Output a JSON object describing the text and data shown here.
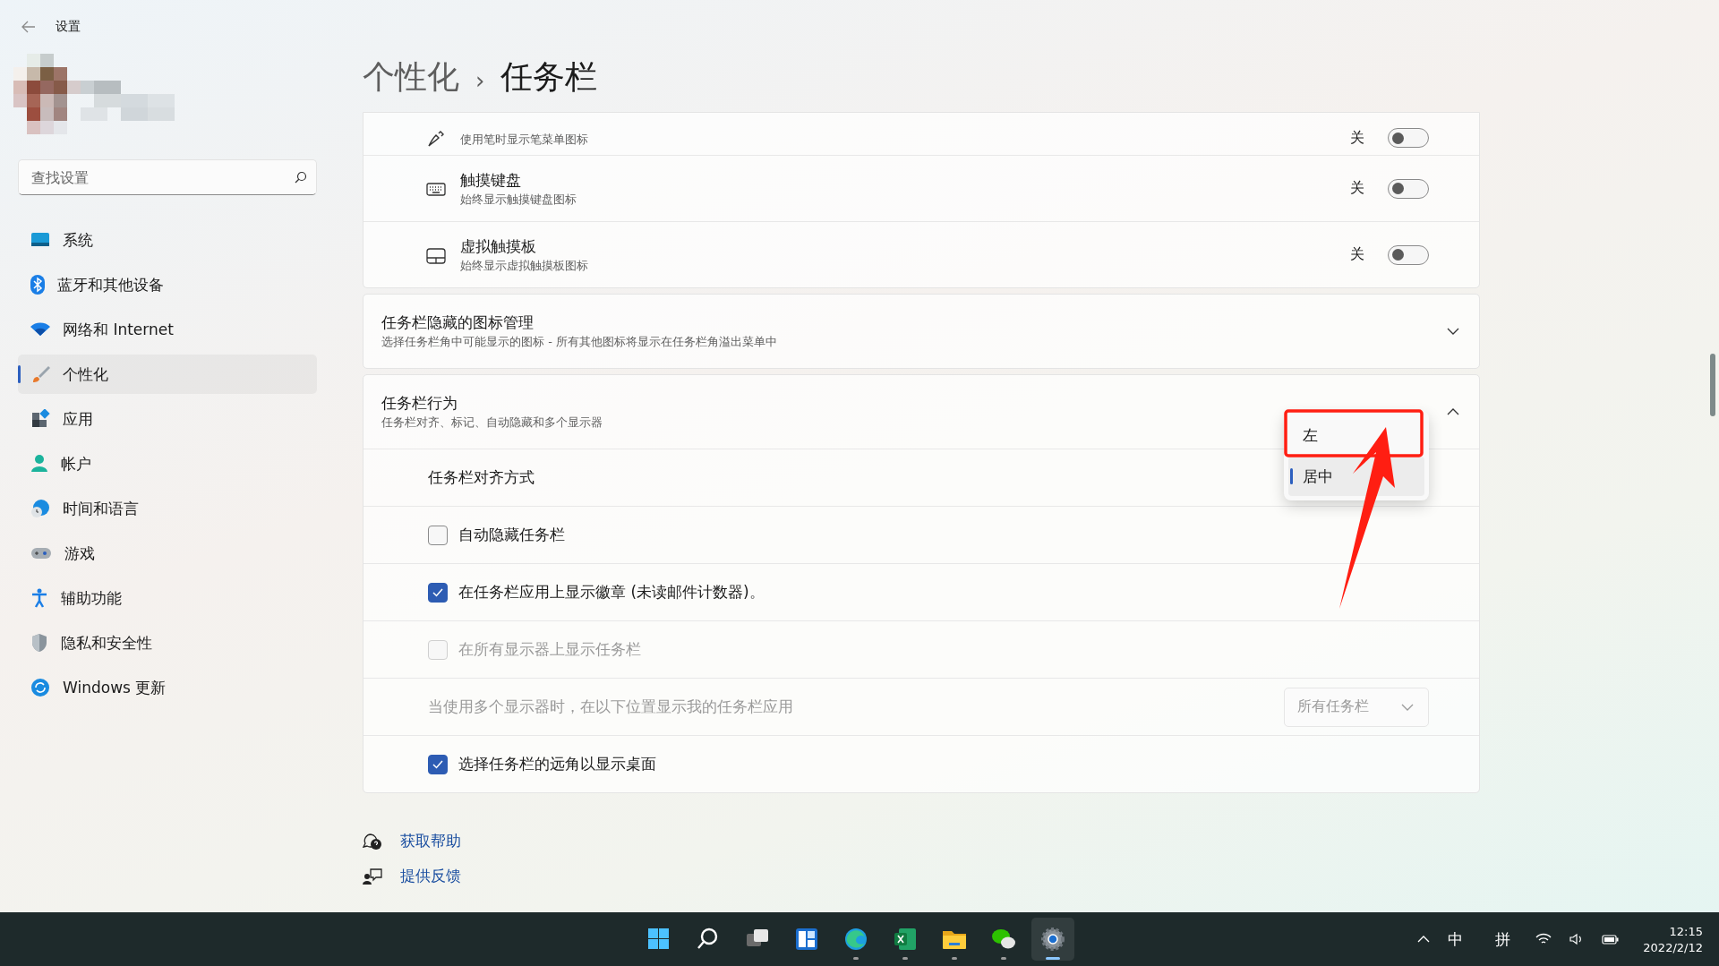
{
  "window": {
    "title": "设置"
  },
  "sidebar": {
    "search": {
      "placeholder": "查找设置"
    },
    "items": [
      {
        "label": "系统",
        "selected": false
      },
      {
        "label": "蓝牙和其他设备",
        "selected": false
      },
      {
        "label": "网络和 Internet",
        "selected": false
      },
      {
        "label": "个性化",
        "selected": true
      },
      {
        "label": "应用",
        "selected": false
      },
      {
        "label": "帐户",
        "selected": false
      },
      {
        "label": "时间和语言",
        "selected": false
      },
      {
        "label": "游戏",
        "selected": false
      },
      {
        "label": "辅助功能",
        "selected": false
      },
      {
        "label": "隐私和安全性",
        "selected": false
      },
      {
        "label": "Windows 更新",
        "selected": false
      }
    ]
  },
  "breadcrumb": {
    "parent": "个性化",
    "separator": "›",
    "current": "任务栏"
  },
  "corner_icons": {
    "rows": [
      {
        "subtitle": "使用笔时显示笔菜单图标",
        "state": "关",
        "on": false
      },
      {
        "title": "触摸键盘",
        "subtitle": "始终显示触摸键盘图标",
        "state": "关",
        "on": false
      },
      {
        "title": "虚拟触摸板",
        "subtitle": "始终显示虚拟触摸板图标",
        "state": "关",
        "on": false
      }
    ]
  },
  "hidden_icons": {
    "title": "任务栏隐藏的图标管理",
    "subtitle": "选择任务栏角中可能显示的图标 - 所有其他图标将显示在任务栏角溢出菜单中",
    "expanded": false
  },
  "behavior": {
    "title": "任务栏行为",
    "subtitle": "任务栏对齐、标记、自动隐藏和多个显示器",
    "expanded": true,
    "alignment": {
      "label": "任务栏对齐方式",
      "options": [
        {
          "label": "左",
          "selected": false
        },
        {
          "label": "居中",
          "selected": true
        }
      ]
    },
    "options": [
      {
        "kind": "checkbox",
        "label": "自动隐藏任务栏",
        "checked": false,
        "disabled": false
      },
      {
        "kind": "checkbox",
        "label": "在任务栏应用上显示徽章 (未读邮件计数器)。",
        "checked": true,
        "disabled": false
      },
      {
        "kind": "checkbox",
        "label": "在所有显示器上显示任务栏",
        "checked": false,
        "disabled": true
      },
      {
        "kind": "dropdown",
        "label": "当使用多个显示器时，在以下位置显示我的任务栏应用",
        "value": "所有任务栏",
        "disabled": true
      },
      {
        "kind": "checkbox",
        "label": "选择任务栏的远角以显示桌面",
        "checked": true,
        "disabled": false
      }
    ]
  },
  "links": [
    "获取帮助",
    "提供反馈"
  ],
  "taskbar": {
    "apps": [
      {
        "running": false,
        "selected": false
      },
      {
        "running": false,
        "selected": false
      },
      {
        "running": false,
        "selected": false
      },
      {
        "running": false,
        "selected": false
      },
      {
        "running": true,
        "selected": false
      },
      {
        "running": true,
        "selected": false
      },
      {
        "running": true,
        "selected": false
      },
      {
        "running": true,
        "selected": false
      },
      {
        "running": true,
        "selected": true
      }
    ],
    "ime": [
      "中",
      "拼"
    ],
    "time": "12:15",
    "date": "2022/2/12"
  }
}
